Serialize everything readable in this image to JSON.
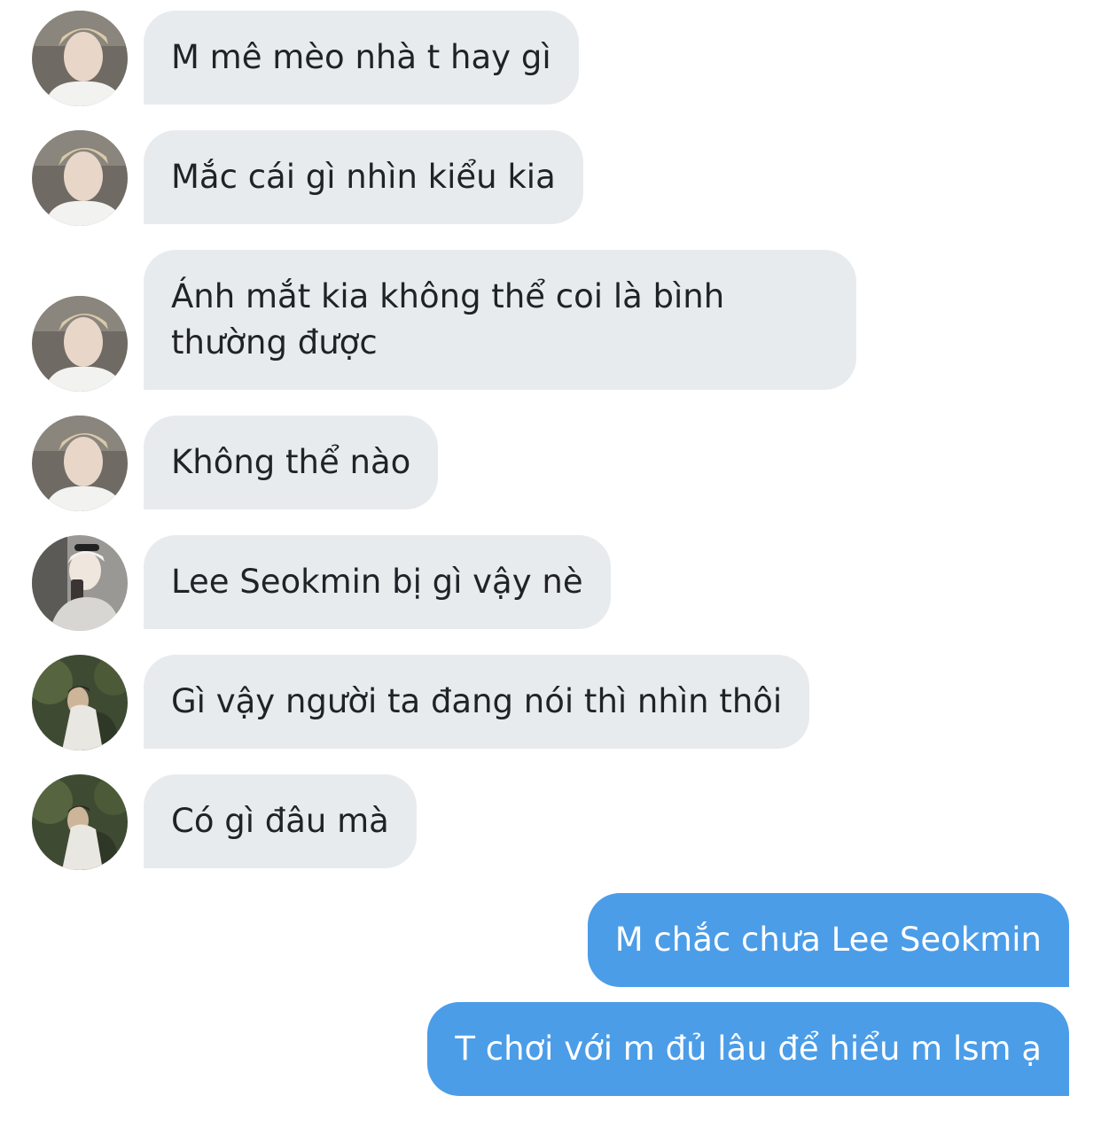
{
  "messages": [
    {
      "direction": "incoming",
      "avatar": "avatar-a",
      "text": "M mê mèo nhà t hay gì"
    },
    {
      "direction": "incoming",
      "avatar": "avatar-a",
      "text": "Mắc cái gì nhìn kiểu kia"
    },
    {
      "direction": "incoming",
      "avatar": "avatar-a",
      "text": "Ánh mắt kia không thể coi là bình thường được"
    },
    {
      "direction": "incoming",
      "avatar": "avatar-a",
      "text": "Không thể nào"
    },
    {
      "direction": "incoming",
      "avatar": "avatar-b",
      "text": "Lee Seokmin bị gì vậy nè"
    },
    {
      "direction": "incoming",
      "avatar": "avatar-c",
      "text": "Gì vậy người ta đang nói thì nhìn thôi"
    },
    {
      "direction": "incoming",
      "avatar": "avatar-c",
      "text": "Có gì đâu mà"
    },
    {
      "direction": "outgoing",
      "text": "M chắc chưa Lee Seokmin"
    },
    {
      "direction": "outgoing",
      "text": "T chơi với m đủ lâu để hiểu m lsm ạ"
    }
  ],
  "colors": {
    "incoming_bubble": "#e8ebee",
    "outgoing_bubble": "#4b9de8",
    "incoming_text": "#1f2328",
    "outgoing_text": "#ffffff"
  }
}
